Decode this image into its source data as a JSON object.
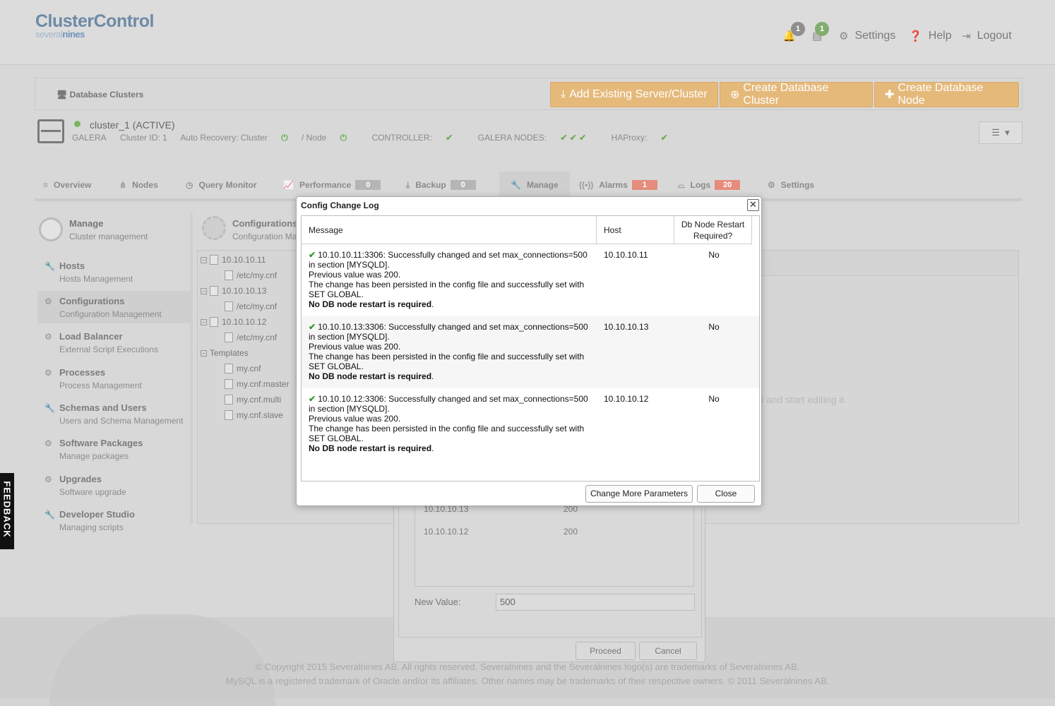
{
  "app": {
    "logo_main": "ClusterControl",
    "logo_sub_a": "several",
    "logo_sub_b": "nines"
  },
  "topbar": {
    "alarm_count": "1",
    "jobs_count": "1",
    "settings_label": "Settings",
    "help_label": "Help",
    "logout_label": "Logout"
  },
  "header": {
    "breadcrumb": "Database Clusters",
    "add_existing": "Add Existing Server/Cluster",
    "create_cluster": "Create Database Cluster",
    "create_node": "Create Database Node"
  },
  "cluster": {
    "name": "cluster_1 (ACTIVE)",
    "type": "GALERA",
    "id": "Cluster ID: 1",
    "auto_recovery_cluster": "Auto Recovery: Cluster",
    "auto_recovery_node": "/ Node",
    "controller": "CONTROLLER:",
    "galera_nodes": "GALERA NODES:",
    "haproxy": "HAProxy:"
  },
  "tabs": [
    {
      "label": "Overview"
    },
    {
      "label": "Nodes"
    },
    {
      "label": "Query Monitor"
    },
    {
      "label": "Performance",
      "badge": "0"
    },
    {
      "label": "Backup",
      "badge": "0"
    },
    {
      "label": "Manage"
    },
    {
      "label": "Alarms",
      "badge": "1"
    },
    {
      "label": "Logs",
      "badge": "20"
    },
    {
      "label": "Settings"
    }
  ],
  "sidebar": {
    "title": "Manage",
    "subtitle": "Cluster management",
    "items": [
      {
        "title": "Hosts",
        "sub": "Hosts Management"
      },
      {
        "title": "Configurations",
        "sub": "Configuration Management"
      },
      {
        "title": "Load Balancer",
        "sub": "External Script Executions"
      },
      {
        "title": "Processes",
        "sub": "Process Management"
      },
      {
        "title": "Schemas and Users",
        "sub": "Users and Schema Management"
      },
      {
        "title": "Software Packages",
        "sub": "Manage packages"
      },
      {
        "title": "Upgrades",
        "sub": "Software upgrade"
      },
      {
        "title": "Developer Studio",
        "sub": "Managing scripts"
      }
    ]
  },
  "content": {
    "title": "Configurations",
    "subtitle": "Configuration Ma",
    "tree": [
      {
        "label": "10.10.10.11",
        "kind": "host"
      },
      {
        "label": "/etc/my.cnf",
        "kind": "file"
      },
      {
        "label": "10.10.10.13",
        "kind": "host"
      },
      {
        "label": "/etc/my.cnf",
        "kind": "file"
      },
      {
        "label": "10.10.10.12",
        "kind": "host"
      },
      {
        "label": "/etc/my.cnf",
        "kind": "file"
      },
      {
        "label": "Templates",
        "kind": "folder"
      },
      {
        "label": "my.cnf",
        "kind": "template"
      },
      {
        "label": "my.cnf.master",
        "kind": "template"
      },
      {
        "label": "my.cnf.multi",
        "kind": "template"
      },
      {
        "label": "my.cnf.slave",
        "kind": "template"
      }
    ],
    "hint": "l and start editing it"
  },
  "under_dialog": {
    "rows": [
      {
        "host": "10.10.10.13",
        "value": "200"
      },
      {
        "host": "10.10.10.12",
        "value": "200"
      }
    ],
    "new_value_label": "New Value:",
    "new_value": "500",
    "proceed": "Proceed",
    "cancel": "Cancel"
  },
  "modal": {
    "title": "Config Change Log",
    "close_glyph": "✕",
    "col_message": "Message",
    "col_host": "Host",
    "col_restart": "Db Node Restart Required?",
    "rows": [
      {
        "line1": "10.10.10.11:3306: Successfully changed and set max_connections=500",
        "line2": "in section [MYSQLD].",
        "line3": "Previous value was 200.",
        "line4": "The change has been persisted in the config file and successfully set with",
        "line5": "SET GLOBAL.",
        "line6": "No DB node restart is required",
        "host": "10.10.10.11",
        "restart": "No"
      },
      {
        "line1": "10.10.10.13:3306: Successfully changed and set max_connections=500",
        "line2": "in section [MYSQLD].",
        "line3": "Previous value was 200.",
        "line4": "The change has been persisted in the config file and successfully set with",
        "line5": "SET GLOBAL.",
        "line6": "No DB node restart is required",
        "host": "10.10.10.13",
        "restart": "No"
      },
      {
        "line1": "10.10.10.12:3306: Successfully changed and set max_connections=500",
        "line2": "in section [MYSQLD].",
        "line3": "Previous value was 200.",
        "line4": "The change has been persisted in the config file and successfully set with",
        "line5": "SET GLOBAL.",
        "line6": "No DB node restart is required",
        "host": "10.10.10.12",
        "restart": "No"
      }
    ],
    "btn_change_more": "Change More Parameters",
    "btn_close": "Close"
  },
  "footer": {
    "line1": "© Copyright 2015 Severalnines AB. All rights reserved. Severalnines and the Severalnines logo(s) are trademarks of Severalnines AB.",
    "line2": "MySQL is a registered trademark of Oracle and/or its affiliates. Other names may be trademarks of their respective owners. © 2011 Severalnines AB."
  },
  "feedback_label": "FEEDBACK",
  "colors": {
    "accent_orange": "#e5b97a",
    "success_green": "#2e9b2e",
    "badge_red": "#e58c7c"
  }
}
